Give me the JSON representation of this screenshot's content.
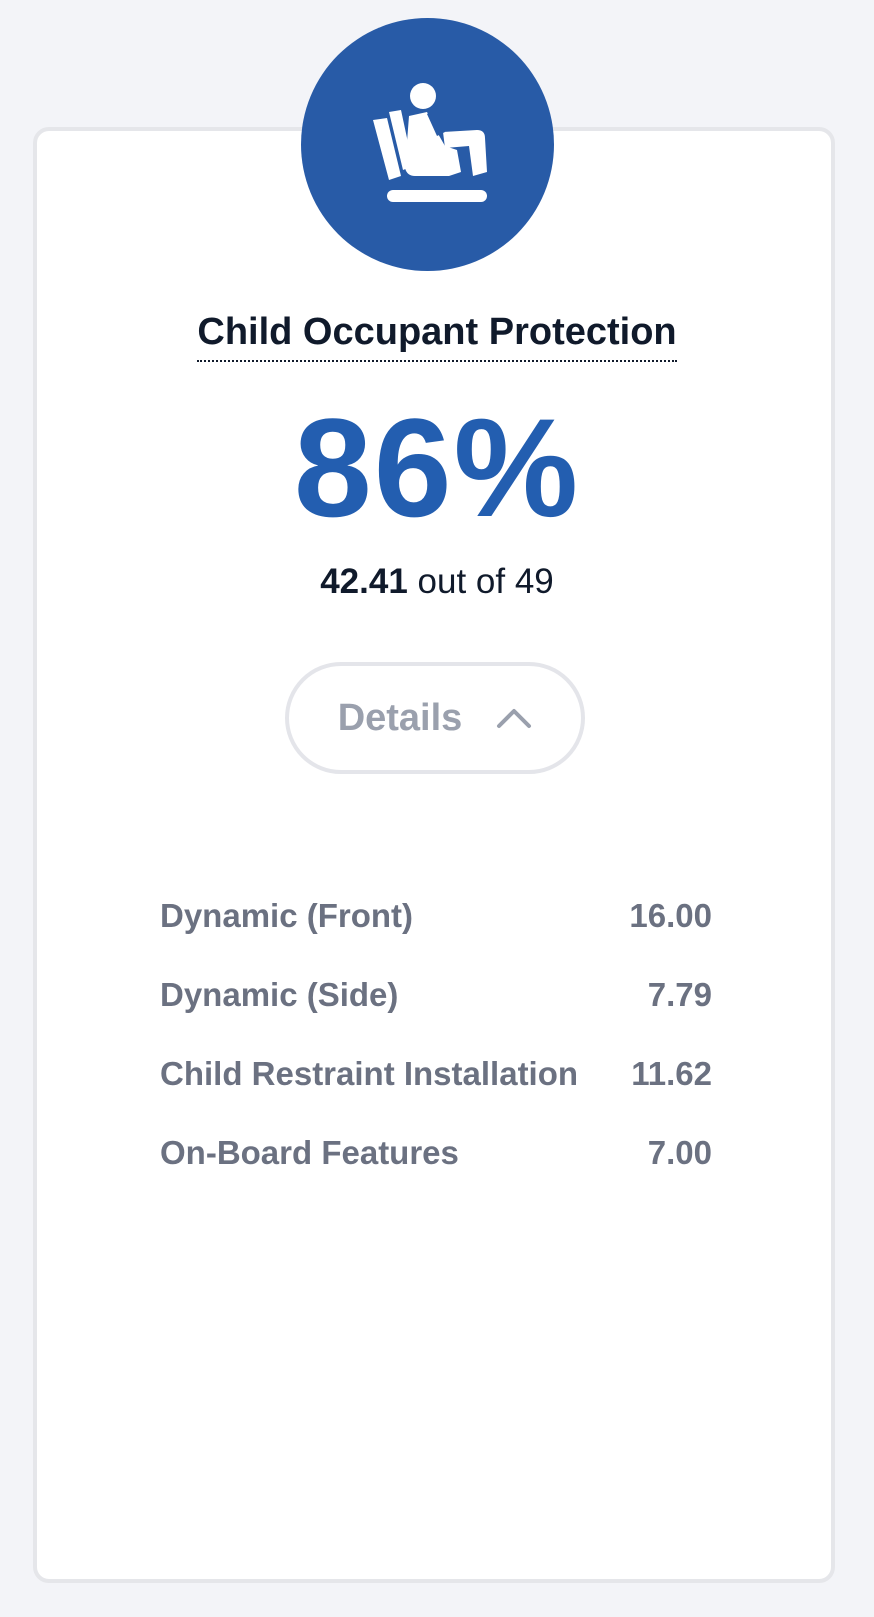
{
  "section": {
    "icon": "child-seat-icon",
    "title": "Child Occupant Protection",
    "percentage": "86%",
    "score_value": "42.41",
    "score_suffix": "out of 49",
    "details_label": "Details",
    "details_toggle_icon": "chevron-up-icon"
  },
  "breakdown": [
    {
      "label": "Dynamic (Front)",
      "value": "16.00"
    },
    {
      "label": "Dynamic (Side)",
      "value": "7.79"
    },
    {
      "label": "Child Restraint Installation",
      "value": "11.62"
    },
    {
      "label": "On-Board Features",
      "value": "7.00"
    }
  ],
  "colors": {
    "accent": "#285ba7",
    "percentage": "#235eb0",
    "text_dark": "#101a2b",
    "text_muted": "#6b7181",
    "background": "#f3f4f8"
  }
}
